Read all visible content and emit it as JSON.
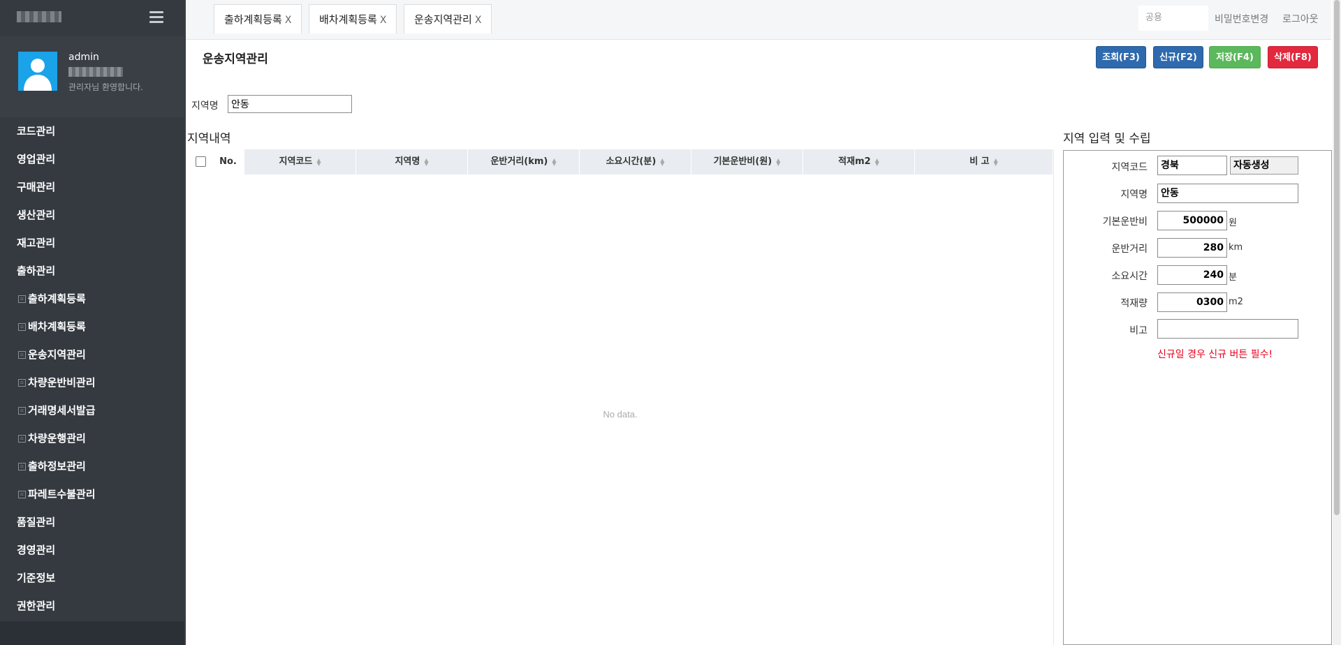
{
  "sidebar": {
    "user": {
      "name": "admin",
      "welcome": "관리자님 환영합니다."
    },
    "menu": [
      {
        "label": "코드관리"
      },
      {
        "label": "영업관리"
      },
      {
        "label": "구매관리"
      },
      {
        "label": "생산관리"
      },
      {
        "label": "재고관리"
      },
      {
        "label": "출하관리"
      },
      {
        "label": "출하계획등록"
      },
      {
        "label": "배차계획등록"
      },
      {
        "label": "운송지역관리"
      },
      {
        "label": "차량운반비관리"
      },
      {
        "label": "거래명세서발급"
      },
      {
        "label": "차량운행관리"
      },
      {
        "label": "출하정보관리"
      },
      {
        "label": "파레트수불관리"
      },
      {
        "label": "품질관리"
      },
      {
        "label": "경영관리"
      },
      {
        "label": "기준정보"
      },
      {
        "label": "권한관리"
      }
    ]
  },
  "tabs": [
    {
      "label": "출하계획등록",
      "close": "X"
    },
    {
      "label": "배차계획등록",
      "close": "X"
    },
    {
      "label": "운송지역관리",
      "close": "X"
    }
  ],
  "header": {
    "company_placeholder": "공용",
    "change_password": "비밀번호변경",
    "logout": "로그아웃"
  },
  "page": {
    "title": "운송지역관리",
    "buttons": {
      "search": "조회(F3)",
      "new": "신규(F2)",
      "save": "저장(F4)",
      "delete": "삭제(F8)"
    },
    "filter": {
      "label": "지역명",
      "value": "안동"
    }
  },
  "grid": {
    "title": "지역내역",
    "columns": [
      "No.",
      "지역코드",
      "지역명",
      "운반거리(km)",
      "소요시간(분)",
      "기본운반비(원)",
      "적재m2",
      "비 고"
    ],
    "rows": [],
    "empty_text": "No data."
  },
  "form": {
    "title": "지역 입력 및 수립",
    "fields": {
      "region_code": {
        "label": "지역코드",
        "value": "경북",
        "auto_label": "자동생성"
      },
      "region_name": {
        "label": "지역명",
        "value": "안동"
      },
      "base_fee": {
        "label": "기본운반비",
        "value": "500000",
        "unit": "원"
      },
      "distance": {
        "label": "운반거리",
        "value": "280",
        "unit": "km"
      },
      "duration": {
        "label": "소요시간",
        "value": "240",
        "unit": "분"
      },
      "load": {
        "label": "적재량",
        "value": "0300",
        "unit": "m2"
      },
      "remark": {
        "label": "비고",
        "value": ""
      }
    },
    "warning": "신규일 경우 신규 버튼 필수!"
  }
}
